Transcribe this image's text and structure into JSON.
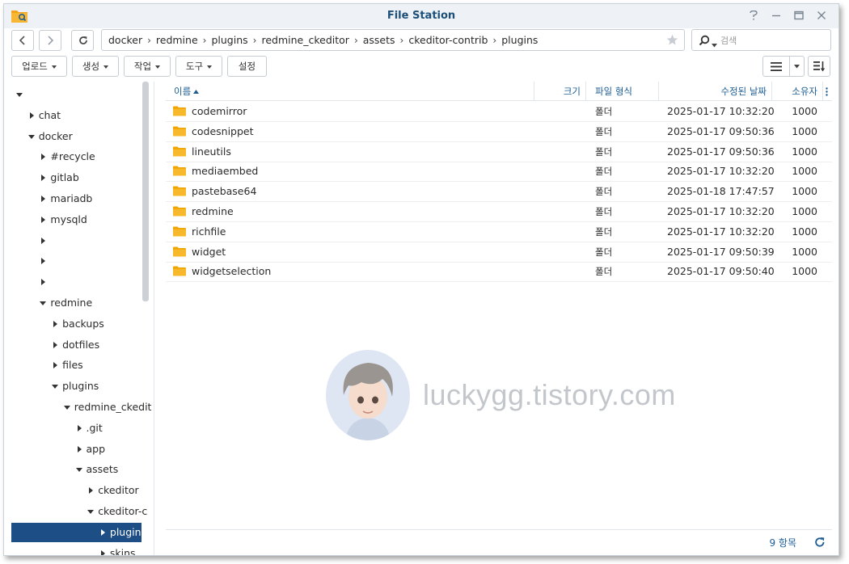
{
  "window": {
    "title": "File Station"
  },
  "nav": {
    "breadcrumbs": [
      "docker",
      "redmine",
      "plugins",
      "redmine_ckeditor",
      "assets",
      "ckeditor-contrib",
      "plugins"
    ],
    "search_placeholder": "검색"
  },
  "toolbar": {
    "upload_label": "업로드",
    "create_label": "생성",
    "action_label": "작업",
    "tools_label": "도구",
    "settings_label": "설정"
  },
  "tree": {
    "items": [
      {
        "label": "",
        "expanded": true
      },
      {
        "label": "chat",
        "expanded": false
      },
      {
        "label": "docker",
        "expanded": true
      },
      {
        "label": "#recycle",
        "expanded": false
      },
      {
        "label": "gitlab",
        "expanded": false
      },
      {
        "label": "mariadb",
        "expanded": false
      },
      {
        "label": "mysqld",
        "expanded": false
      },
      {
        "label": "",
        "expanded": false
      },
      {
        "label": "",
        "expanded": false
      },
      {
        "label": "",
        "expanded": false
      },
      {
        "label": "redmine",
        "expanded": true
      },
      {
        "label": "backups",
        "expanded": false
      },
      {
        "label": "dotfiles",
        "expanded": false
      },
      {
        "label": "files",
        "expanded": false
      },
      {
        "label": "plugins",
        "expanded": true
      },
      {
        "label": "redmine_ckedit",
        "expanded": true
      },
      {
        "label": ".git",
        "expanded": false
      },
      {
        "label": "app",
        "expanded": false
      },
      {
        "label": "assets",
        "expanded": true
      },
      {
        "label": "ckeditor",
        "expanded": false
      },
      {
        "label": "ckeditor-c",
        "expanded": true
      },
      {
        "label": "plugins",
        "expanded": false,
        "selected": true
      },
      {
        "label": "skins",
        "expanded": false
      }
    ]
  },
  "list": {
    "columns": {
      "name": "이름",
      "size": "크기",
      "type": "파일 형식",
      "modified": "수정된 날짜",
      "owner": "소유자"
    },
    "rows": [
      {
        "name": "codemirror",
        "size": "",
        "type": "폴더",
        "modified": "2025-01-17 10:32:20",
        "owner": "1000"
      },
      {
        "name": "codesnippet",
        "size": "",
        "type": "폴더",
        "modified": "2025-01-17 09:50:36",
        "owner": "1000"
      },
      {
        "name": "lineutils",
        "size": "",
        "type": "폴더",
        "modified": "2025-01-17 09:50:36",
        "owner": "1000"
      },
      {
        "name": "mediaembed",
        "size": "",
        "type": "폴더",
        "modified": "2025-01-17 10:32:20",
        "owner": "1000"
      },
      {
        "name": "pastebase64",
        "size": "",
        "type": "폴더",
        "modified": "2025-01-18 17:47:57",
        "owner": "1000"
      },
      {
        "name": "redmine",
        "size": "",
        "type": "폴더",
        "modified": "2025-01-17 10:32:20",
        "owner": "1000"
      },
      {
        "name": "richfile",
        "size": "",
        "type": "폴더",
        "modified": "2025-01-17 10:32:20",
        "owner": "1000"
      },
      {
        "name": "widget",
        "size": "",
        "type": "폴더",
        "modified": "2025-01-17 09:50:39",
        "owner": "1000"
      },
      {
        "name": "widgetselection",
        "size": "",
        "type": "폴더",
        "modified": "2025-01-17 09:50:40",
        "owner": "1000"
      }
    ],
    "item_count": "9 항목"
  },
  "watermark": {
    "text": "luckygg.tistory.com"
  },
  "colors": {
    "accent": "#1e4e86",
    "header_text": "#1d5d93",
    "folder": "#f5b400"
  }
}
